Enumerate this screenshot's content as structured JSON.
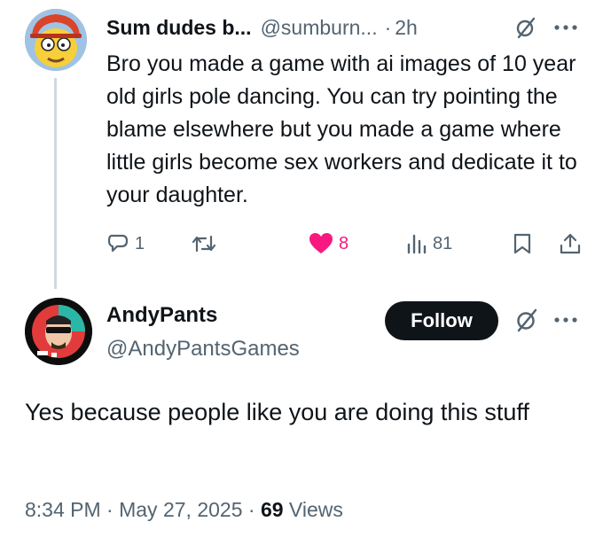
{
  "reply": {
    "name": "Sum dudes b...",
    "handle": "@sumburn...",
    "separator": "·",
    "time": "2h",
    "text": "Bro you made a game with ai images of 10 year old girls pole dancing. You can try pointing the blame elsewhere but you made a game where little girls become sex workers and dedicate it to your daughter.",
    "replies": "1",
    "likes": "8",
    "views": "81",
    "like_color": "#f91880"
  },
  "main": {
    "name": "AndyPants",
    "handle": "@AndyPantsGames",
    "follow_label": "Follow",
    "text": "Yes because people like you are doing this stuff",
    "time": "8:34 PM",
    "sep1": " · ",
    "date": "May 27, 2025",
    "sep2": " · ",
    "views": "69",
    "views_label": " Views"
  },
  "icons": {
    "grok": "grok-icon",
    "more": "more-icon",
    "reply": "reply-icon",
    "retweet": "retweet-icon",
    "like": "heart-icon",
    "views": "views-icon",
    "bookmark": "bookmark-icon",
    "share": "share-icon"
  }
}
